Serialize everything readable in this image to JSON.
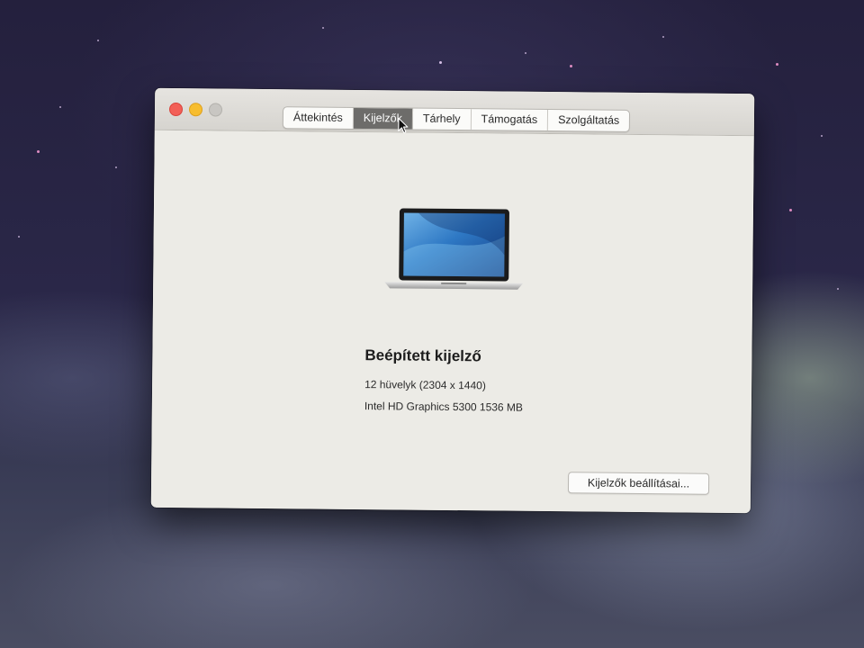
{
  "window": {
    "tabs": [
      {
        "label": "Áttekintés",
        "active": false
      },
      {
        "label": "Kijelzők",
        "active": true
      },
      {
        "label": "Tárhely",
        "active": false
      },
      {
        "label": "Támogatás",
        "active": false
      },
      {
        "label": "Szolgáltatás",
        "active": false
      }
    ],
    "traffic_lights": {
      "close": "#f25f57",
      "minimize": "#f7bd2f",
      "zoom": "#c8c6c2"
    }
  },
  "display": {
    "name": "Beépített kijelző",
    "size_resolution": "12 hüvelyk (2304 x 1440)",
    "graphics": "Intel HD Graphics 5300 1536 MB",
    "image_icon": "laptop-icon"
  },
  "actions": {
    "display_settings_label": "Kijelzők beállításai..."
  },
  "colors": {
    "active_tab_bg": "#6d6c6a",
    "window_bg": "#ecebe6"
  }
}
